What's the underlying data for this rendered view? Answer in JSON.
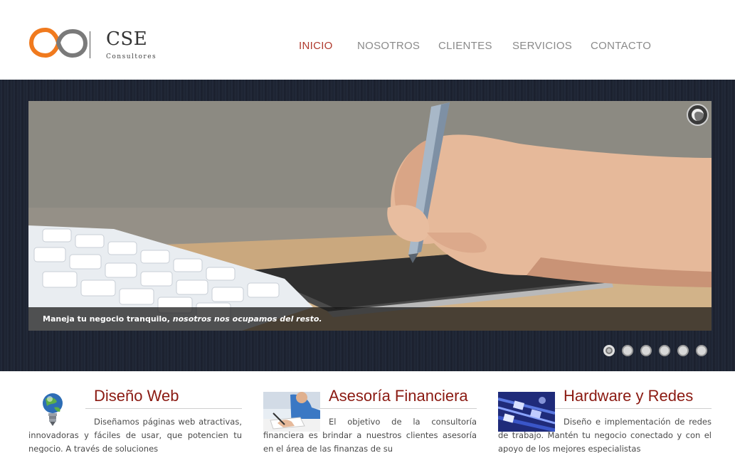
{
  "brand": {
    "name": "CSE",
    "subtitle": "Consultores",
    "logo_colors": {
      "orange": "#f07a1e",
      "gray": "#7a7a7a"
    }
  },
  "nav": {
    "items": [
      {
        "label": "INICIO",
        "active": true
      },
      {
        "label": "NOSOTROS",
        "active": false
      },
      {
        "label": "CLIENTES",
        "active": false
      },
      {
        "label": "SERVICIOS",
        "active": false
      },
      {
        "label": "CONTACTO",
        "active": false
      }
    ],
    "active_color": "#b03a2e",
    "color": "#8a8a8a"
  },
  "slider": {
    "caption_plain": "Maneja tu negocio tranquilo, ",
    "caption_italic": "nosotros nos ocupamos del resto.",
    "dots_count": 6,
    "active_dot": 0,
    "loader_icon": "loading-spinner-icon"
  },
  "features": [
    {
      "title": "Diseño Web",
      "icon": "globe-lightbulb-icon",
      "text": "Diseñamos páginas web atractivas, innovadoras y fáciles de usar, que potencien tu negocio. A través de soluciones"
    },
    {
      "title": "Asesoría Financiera",
      "icon": "person-writing-photo",
      "text": "El objetivo de la consultoría financiera es brindar a nuestros clientes asesoría en el área de las finanzas de su"
    },
    {
      "title": "Hardware y Redes",
      "icon": "network-cables-photo",
      "text": "Diseño e implementación de redes de trabajo. Mantén tu negocio conectado y con el apoyo de los mejores especialistas"
    }
  ],
  "colors": {
    "title_red": "#8b1a12",
    "band_dark": "#1b2130"
  }
}
